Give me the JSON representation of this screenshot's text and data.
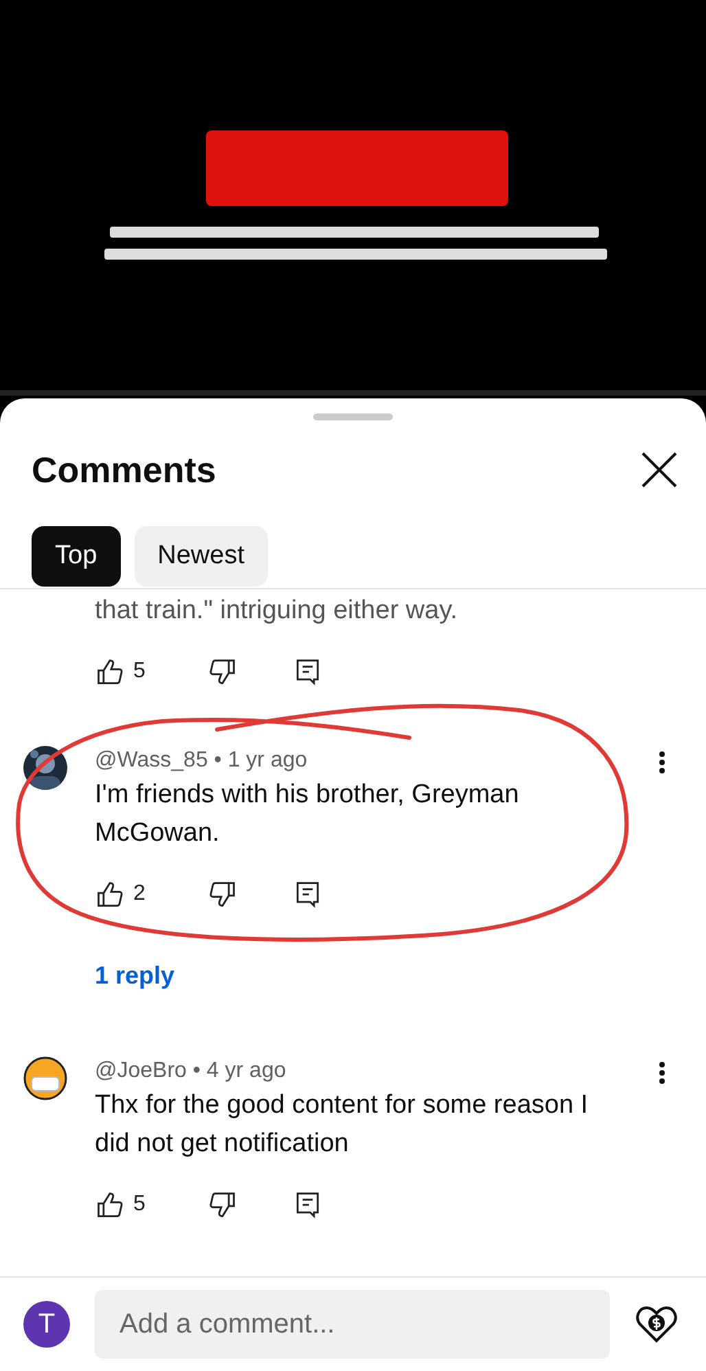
{
  "panel": {
    "title": "Comments"
  },
  "tabs": [
    {
      "label": "Top",
      "selected": true
    },
    {
      "label": "Newest",
      "selected": false
    }
  ],
  "comments": [
    {
      "kind": "partial",
      "text": "that train.\" intriguing either way.",
      "likes": "5"
    },
    {
      "kind": "full",
      "meta": "@Wass_85 • 1 yr ago",
      "text": "I'm friends with his brother, Greyman McGowan.",
      "likes": "2",
      "replies": "1 reply",
      "annotated": true
    },
    {
      "kind": "full",
      "avatar": {
        "kind": "emoji"
      },
      "meta": "@JoeBro • 4 yr ago",
      "text": "Thx for the good content for some reason I did not get notification",
      "likes": "5",
      "annotated": false
    }
  ],
  "composer": {
    "avatar_letter": "T",
    "placeholder": "Add a comment..."
  }
}
